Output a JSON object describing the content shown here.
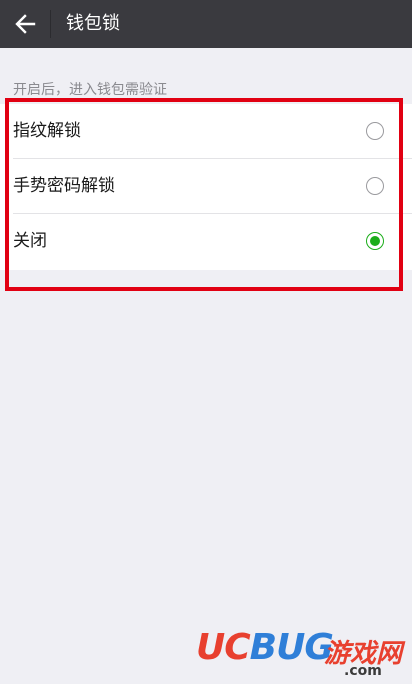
{
  "header": {
    "title": "钱包锁",
    "back_icon": "arrow-left-icon"
  },
  "hint": "开启后，进入钱包需验证",
  "options": [
    {
      "label": "指纹解锁",
      "selected": false
    },
    {
      "label": "手势密码解锁",
      "selected": false
    },
    {
      "label": "关闭",
      "selected": true
    }
  ],
  "colors": {
    "header_bg": "#3a3a3f",
    "accent_green": "#1aad19",
    "highlight_red": "#e10012"
  },
  "watermark": {
    "logo_uc": "UC",
    "logo_bug": "BUG",
    "text": "游戏网",
    "domain": ".com"
  }
}
